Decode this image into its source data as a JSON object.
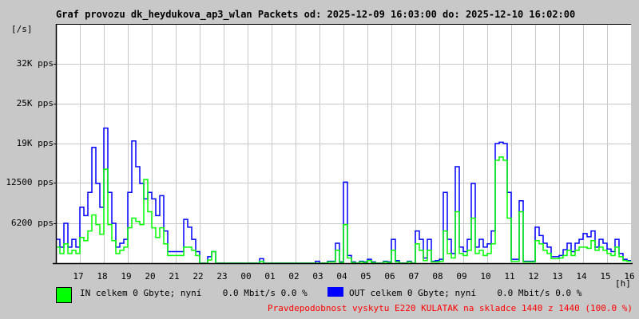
{
  "title": "Graf provozu dk_heydukova_ap3_wlan Packets od: 2025-12-09 16:03:00 do: 2025-12-10 16:02:00",
  "legend": {
    "in_text": "IN celkem 0 Gbyte; nyní    0.0 Mbit/s 0.0 %",
    "out_text": "OUT celkem 0 Gbyte; nyní    0.0 Mbit/s 0.0 %",
    "in_color": "#00ff00",
    "out_color": "#0000ff"
  },
  "footer": "Pravdepodobnost vyskytu E220 KULATAK na skladce 1440 z 1440 (100.0 %)",
  "chart_data": {
    "type": "line",
    "title": "Graf provozu dk_heydukova_ap3_wlan Packets od: 2025-12-09 16:03:00 do: 2025-12-10 16:02:00",
    "ylabel": "[/s]",
    "xlabel": "[h]",
    "ylim": [
      0,
      37200
    ],
    "xlim_hours": [
      0,
      24
    ],
    "sample_interval_min": 10,
    "grid": true,
    "yticks": [
      {
        "value": 6200,
        "label": "6200 pps"
      },
      {
        "value": 12500,
        "label": "12500 pps"
      },
      {
        "value": 18600,
        "label": "19K pps"
      },
      {
        "value": 24800,
        "label": "25K pps"
      },
      {
        "value": 31000,
        "label": "32K pps"
      }
    ],
    "xticks": [
      "17",
      "18",
      "19",
      "20",
      "21",
      "22",
      "23",
      "00",
      "01",
      "02",
      "03",
      "04",
      "05",
      "06",
      "07",
      "08",
      "09",
      "10",
      "11",
      "12",
      "13",
      "14",
      "15",
      "16"
    ],
    "series": [
      {
        "name": "OUT",
        "color": "#0000ff",
        "values": [
          3700,
          2500,
          6200,
          2500,
          3700,
          2500,
          8700,
          7400,
          11000,
          18000,
          12400,
          8700,
          21000,
          11000,
          6200,
          2500,
          3100,
          3700,
          11000,
          19000,
          15000,
          12400,
          10000,
          11000,
          10000,
          7400,
          10500,
          5000,
          1800,
          1800,
          1800,
          1800,
          6800,
          5600,
          3700,
          1800,
          0,
          0,
          1000,
          1800,
          0,
          0,
          0,
          0,
          0,
          0,
          0,
          0,
          0,
          0,
          0,
          700,
          0,
          0,
          0,
          0,
          0,
          0,
          0,
          0,
          0,
          0,
          0,
          0,
          0,
          300,
          0,
          0,
          300,
          300,
          3100,
          200,
          12600,
          1200,
          200,
          0,
          300,
          200,
          600,
          200,
          0,
          0,
          300,
          200,
          3700,
          400,
          0,
          0,
          300,
          0,
          5000,
          3700,
          800,
          3700,
          300,
          400,
          600,
          11000,
          3700,
          1500,
          15000,
          2500,
          1800,
          3700,
          12400,
          2500,
          3700,
          2500,
          3000,
          5000,
          18600,
          18800,
          18600,
          11000,
          600,
          600,
          9700,
          300,
          300,
          300,
          5600,
          4300,
          3100,
          2500,
          1000,
          1000,
          1200,
          2100,
          3100,
          1800,
          3100,
          3700,
          4600,
          4100,
          5000,
          2500,
          3700,
          3100,
          2200,
          1800,
          3700,
          1500,
          600,
          400
        ]
      },
      {
        "name": "IN",
        "color": "#00ff00",
        "values": [
          2500,
          1500,
          3000,
          1500,
          2000,
          1500,
          4000,
          3500,
          5000,
          7500,
          6000,
          4500,
          14600,
          6000,
          3500,
          1500,
          2000,
          2500,
          5500,
          7000,
          6500,
          6000,
          13000,
          8000,
          5500,
          4000,
          5500,
          3000,
          1200,
          1200,
          1200,
          1200,
          2500,
          2500,
          2000,
          1200,
          0,
          0,
          500,
          1800,
          0,
          0,
          0,
          0,
          0,
          0,
          0,
          0,
          0,
          0,
          0,
          300,
          0,
          0,
          0,
          0,
          0,
          0,
          0,
          0,
          0,
          0,
          0,
          0,
          0,
          0,
          0,
          0,
          200,
          200,
          2000,
          100,
          6000,
          800,
          100,
          0,
          200,
          100,
          400,
          100,
          0,
          0,
          200,
          100,
          2000,
          200,
          0,
          0,
          200,
          0,
          3000,
          2000,
          400,
          2000,
          200,
          200,
          300,
          5000,
          1500,
          800,
          8000,
          1500,
          1200,
          2000,
          7000,
          1500,
          2000,
          1200,
          1500,
          3000,
          16000,
          16500,
          16000,
          7000,
          300,
          300,
          8000,
          200,
          200,
          200,
          3500,
          3000,
          2000,
          1500,
          700,
          700,
          800,
          1200,
          2000,
          1200,
          2000,
          2500,
          2500,
          2300,
          3500,
          2000,
          2500,
          2000,
          1500,
          1200,
          2500,
          1000,
          400,
          300
        ]
      }
    ]
  }
}
